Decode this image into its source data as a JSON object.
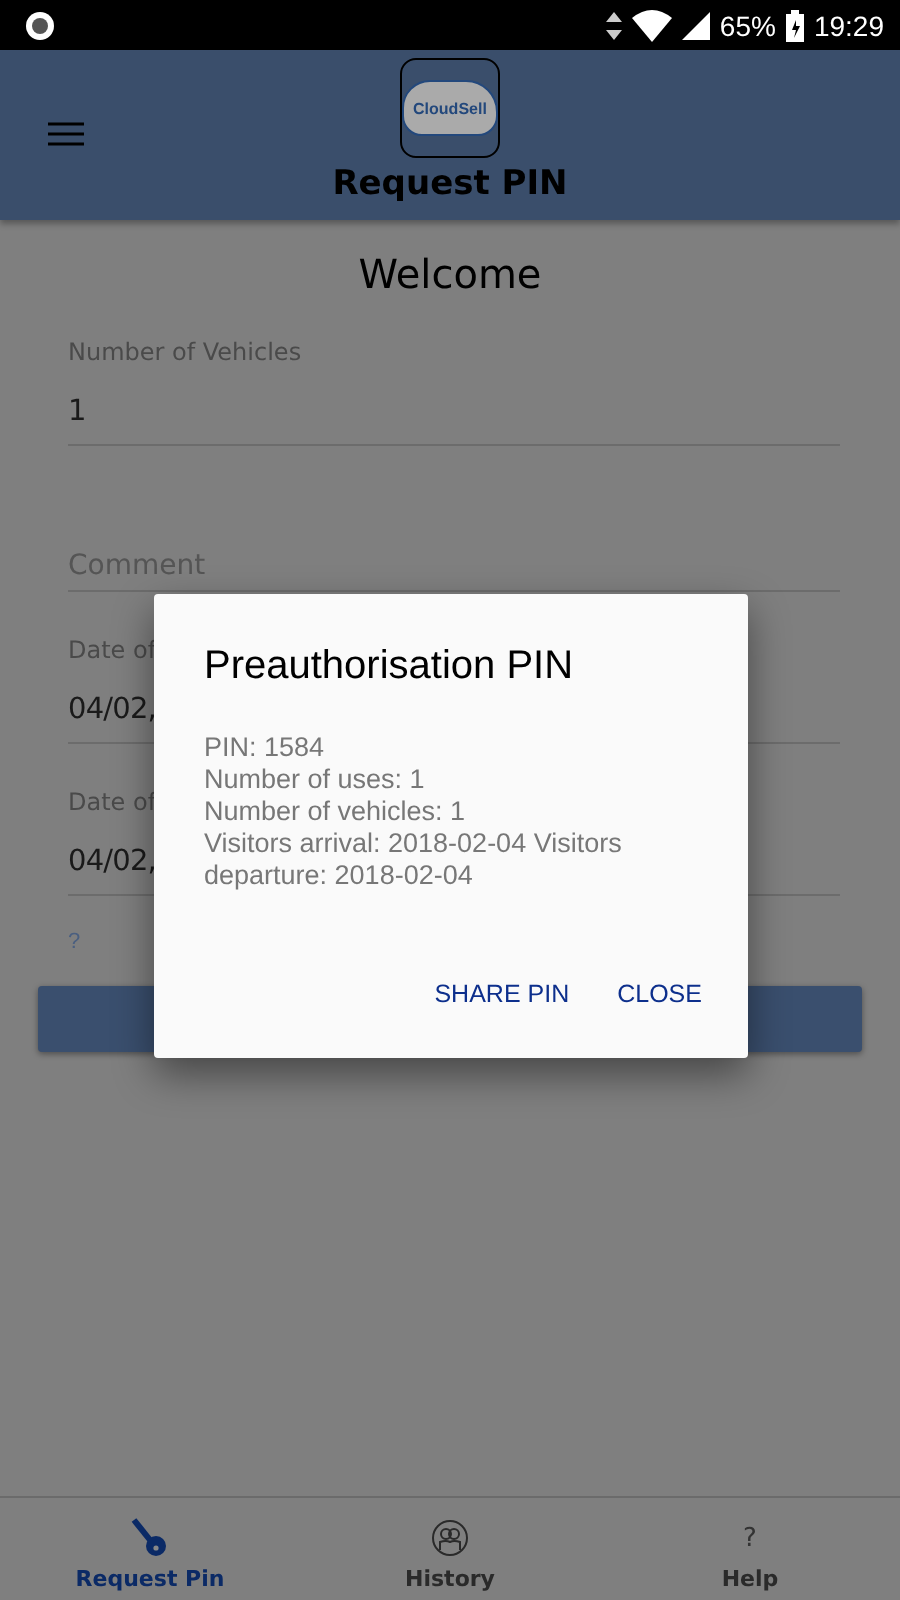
{
  "status_bar": {
    "battery": "65%",
    "time": "19:29"
  },
  "header": {
    "logo_text": "CloudSell",
    "title": "Request PIN"
  },
  "form": {
    "heading": "Welcome",
    "fields": [
      {
        "label": "Number of Vehicles",
        "value": "1"
      },
      {
        "placeholder": "Comment"
      },
      {
        "label": "Date of",
        "value": "04/02,"
      },
      {
        "label": "Date of",
        "value": "04/02,"
      }
    ],
    "help_link": "?"
  },
  "dialog": {
    "title": "Preauthorisation PIN",
    "lines": [
      "PIN: 1584",
      "Number of uses: 1",
      "Number of vehicles: 1",
      "Visitors arrival: 2018-02-04 Visitors departure: 2018-02-04"
    ],
    "buttons": [
      "SHARE PIN",
      "CLOSE"
    ]
  },
  "bottom_nav": [
    {
      "label": "Request Pin",
      "kind": "key",
      "selected": true
    },
    {
      "label": "History",
      "kind": "people",
      "selected": false
    },
    {
      "label": "Help",
      "kind": "glyph",
      "glyph": "?",
      "selected": false
    }
  ]
}
